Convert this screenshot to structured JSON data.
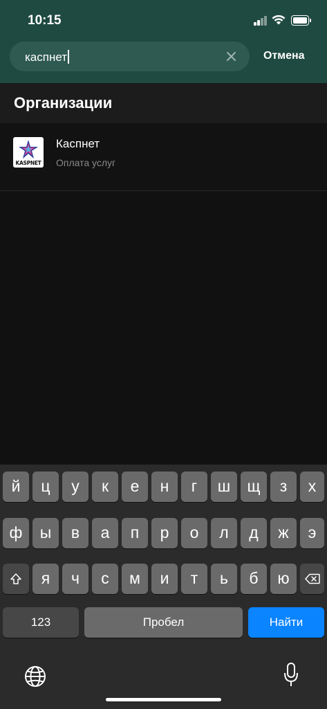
{
  "status_bar": {
    "time": "10:15"
  },
  "search": {
    "value": "каспнет",
    "cancel_label": "Отмена"
  },
  "section": {
    "title": "Организации"
  },
  "results": [
    {
      "title": "Каспнет",
      "subtitle": "Оплата услуг",
      "logo_text": "KASPNET"
    }
  ],
  "keyboard": {
    "row1": [
      "й",
      "ц",
      "у",
      "к",
      "е",
      "н",
      "г",
      "ш",
      "щ",
      "з",
      "х"
    ],
    "row2": [
      "ф",
      "ы",
      "в",
      "а",
      "п",
      "р",
      "о",
      "л",
      "д",
      "ж",
      "э"
    ],
    "row3": [
      "я",
      "ч",
      "с",
      "м",
      "и",
      "т",
      "ь",
      "б",
      "ю"
    ],
    "numbers_label": "123",
    "space_label": "Пробел",
    "return_label": "Найти"
  },
  "colors": {
    "header_bg": "#1f4a41",
    "accent_blue": "#0a84ff"
  }
}
